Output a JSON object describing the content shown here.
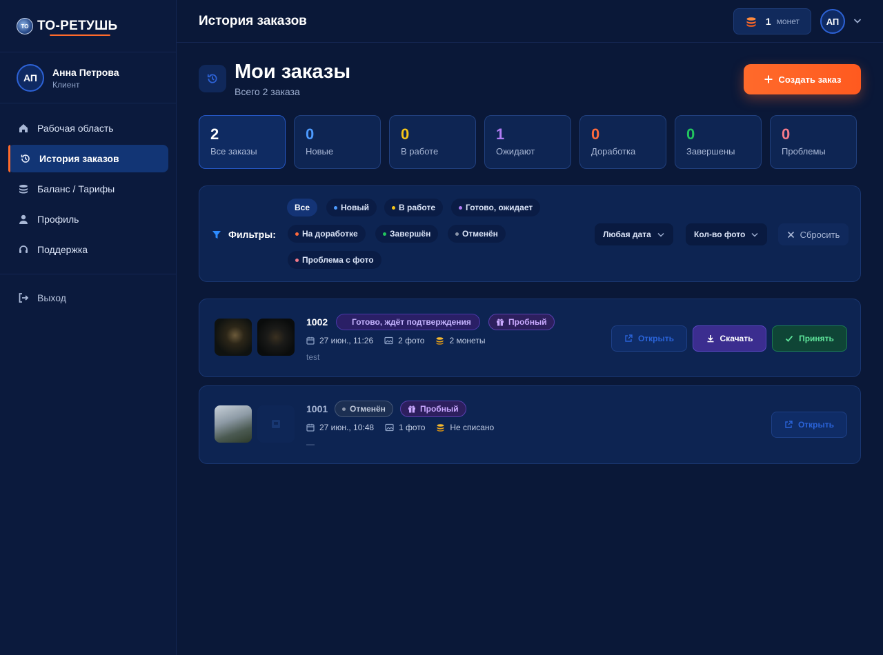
{
  "app": {
    "logo_text": "ТО-РЕТУШЬ",
    "logo_mark": "TO"
  },
  "user": {
    "initials": "АП",
    "name": "Анна Петрова",
    "role": "Клиент"
  },
  "sidebar": {
    "items": [
      {
        "label": "Рабочая область",
        "icon": "home-icon"
      },
      {
        "label": "История заказов",
        "icon": "history-icon"
      },
      {
        "label": "Баланс / Тарифы",
        "icon": "coins-icon"
      },
      {
        "label": "Профиль",
        "icon": "user-icon"
      },
      {
        "label": "Поддержка",
        "icon": "headset-icon"
      }
    ],
    "logout": "Выход"
  },
  "header": {
    "title": "История заказов",
    "coins_count": "1",
    "coins_label": "монет",
    "avatar_initials": "АП"
  },
  "page": {
    "title": "Мои заказы",
    "subtitle": "Всего 2 заказа",
    "create_label": "Создать заказ"
  },
  "stats": [
    {
      "value": "2",
      "label": "Все заказы",
      "color": "#ffffff"
    },
    {
      "value": "0",
      "label": "Новые",
      "color": "#4d9bff"
    },
    {
      "value": "0",
      "label": "В работе",
      "color": "#f5c518"
    },
    {
      "value": "1",
      "label": "Ожидают",
      "color": "#b07cf4"
    },
    {
      "value": "0",
      "label": "Доработка",
      "color": "#ff6a3c"
    },
    {
      "value": "0",
      "label": "Завершены",
      "color": "#22c55e"
    },
    {
      "value": "0",
      "label": "Проблемы",
      "color": "#f47a8a"
    }
  ],
  "filters": {
    "label": "Фильтры:",
    "chips": [
      {
        "label": "Все",
        "color": ""
      },
      {
        "label": "Новый",
        "color": "#4d9bff"
      },
      {
        "label": "В работе",
        "color": "#f5c518"
      },
      {
        "label": "Готово, ожидает",
        "color": "#b07cf4"
      },
      {
        "label": "На доработке",
        "color": "#ff6a3c"
      },
      {
        "label": "Завершён",
        "color": "#22c55e"
      },
      {
        "label": "Отменён",
        "color": "#8a94a8"
      },
      {
        "label": "Проблема с фото",
        "color": "#f47a8a"
      }
    ],
    "date_select": "Любая дата",
    "photo_select": "Кол-во фото",
    "reset_label": "Сбросить"
  },
  "orders": [
    {
      "id": "1002",
      "status": "Готово, ждёт подтверждения",
      "tag": "Пробный",
      "date": "27 июн., 11:26",
      "photos": "2 фото",
      "coins": "2 монеты",
      "note": "test",
      "actions": {
        "open": "Открыть",
        "download": "Скачать",
        "accept": "Принять"
      }
    },
    {
      "id": "1001",
      "status": "Отменён",
      "tag": "Пробный",
      "date": "27 июн., 10:48",
      "photos": "1 фото",
      "coins": "Не списано",
      "note": "—",
      "actions": {
        "open": "Открыть"
      }
    }
  ],
  "colors": {
    "accent": "#ff6a2b",
    "primary": "#2d62d6",
    "background": "#0a1838"
  }
}
